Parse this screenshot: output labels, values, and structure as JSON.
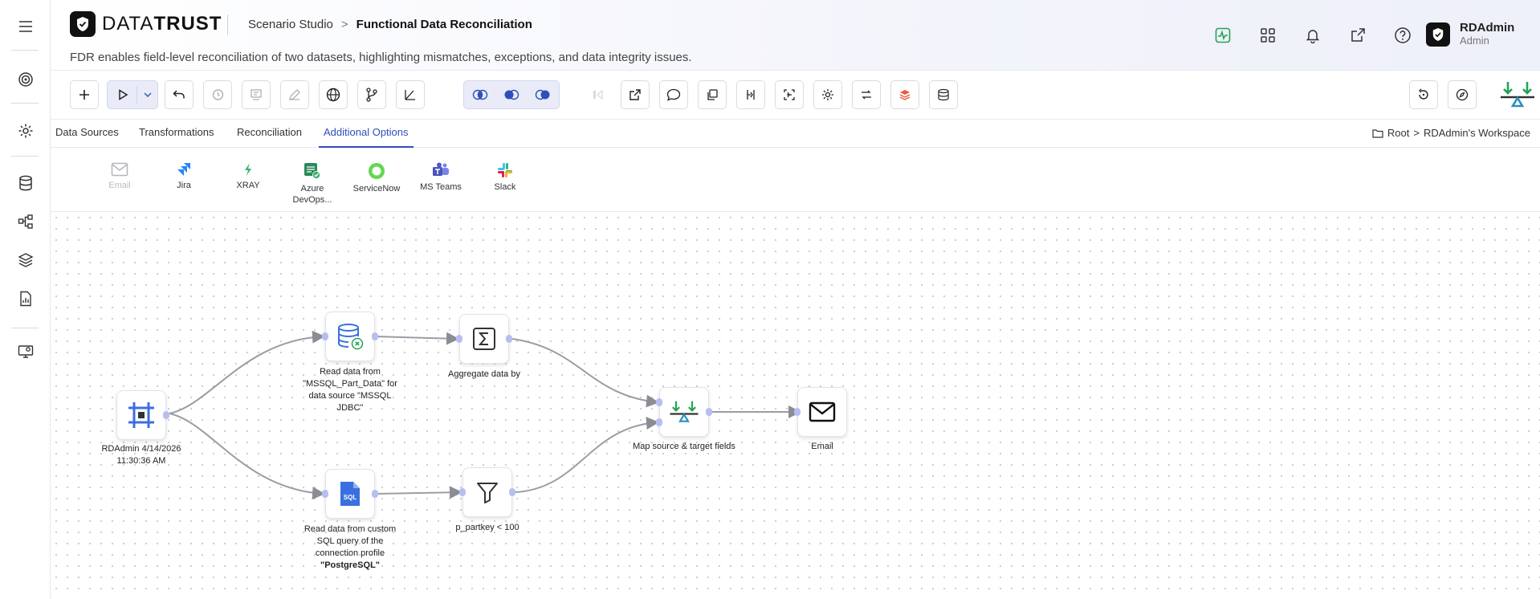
{
  "header": {
    "brand_light": "DATA",
    "brand_bold": "TRUST",
    "breadcrumb_root": "Scenario Studio",
    "breadcrumb_sep": ">",
    "breadcrumb_current": "Functional Data Reconciliation",
    "subtitle": "FDR enables field-level reconciliation of two datasets, highlighting mismatches, exceptions, and data integrity issues.",
    "user_name": "RDAdmin",
    "user_role": "Admin"
  },
  "tabs": [
    {
      "label": "Data Sources"
    },
    {
      "label": "Transformations"
    },
    {
      "label": "Reconciliation"
    },
    {
      "label": "Additional Options",
      "active": true
    }
  ],
  "workspace": {
    "root": "Root",
    "sep": ">",
    "name": "RDAdmin's Workspace"
  },
  "integrations": [
    {
      "label": "Email",
      "icon": "mail-icon",
      "disabled": true
    },
    {
      "label": "Jira",
      "icon": "jira-icon"
    },
    {
      "label": "XRAY",
      "icon": "xray-icon"
    },
    {
      "label": "Azure DevOps...",
      "icon": "azure-devops-icon"
    },
    {
      "label": "ServiceNow",
      "icon": "servicenow-icon"
    },
    {
      "label": "MS Teams",
      "icon": "ms-teams-icon"
    },
    {
      "label": "Slack",
      "icon": "slack-icon"
    }
  ],
  "nodes": {
    "trigger": {
      "label": "RDAdmin 4/14/2026 11:30:36 AM"
    },
    "read_mssql": {
      "label": "Read data from \"MSSQL_Part_Data\" for data source \"MSSQL JDBC\""
    },
    "read_sql": {
      "label_pre": "Read data from custom SQL query of the connection profile ",
      "label_bold": "\"PostgreSQL\""
    },
    "aggregate": {
      "label": "Aggregate data by"
    },
    "filter": {
      "label": "p_partkey < 100"
    },
    "map": {
      "label": "Map source & target fields"
    },
    "email": {
      "label": "Email"
    }
  },
  "colors": {
    "accent": "#2f4fb8",
    "green": "#22a454",
    "teal": "#2b8fbf",
    "port": "#b7bff0"
  }
}
